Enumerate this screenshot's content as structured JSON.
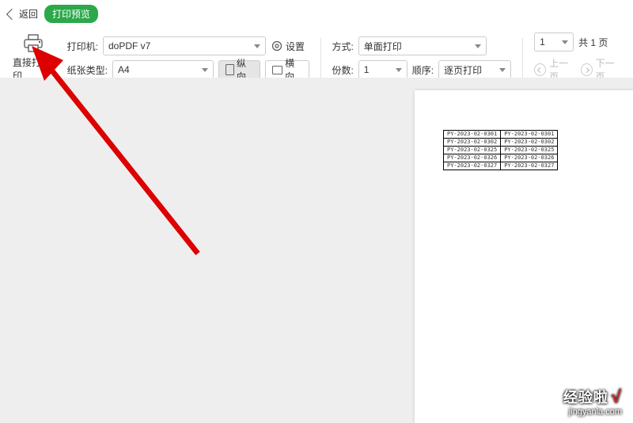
{
  "header": {
    "back": "返回",
    "title": "打印预览"
  },
  "toolbar": {
    "printAction": "直接打印",
    "printerLabel": "打印机:",
    "printer": "doPDF v7",
    "settings": "设置",
    "paperLabel": "纸张类型:",
    "paper": "A4",
    "orientPortrait": "纵向",
    "orientLandscape": "横向",
    "modeLabel": "方式:",
    "mode": "单面打印",
    "copiesLabel": "份数:",
    "copies": "1",
    "orderLabel": "顺序:",
    "order": "逐页打印",
    "pageInput": "1",
    "totalPages": "共 1 页",
    "prevPage": "上一页",
    "nextPage": "下一页"
  },
  "preview": {
    "tableRows": [
      [
        "PY-2023-02-0301",
        "PY-2023-02-0301"
      ],
      [
        "PY-2023-02-0302",
        "PY-2023-02-0302"
      ],
      [
        "PY-2023-02-0325",
        "PY-2023-02-0325"
      ],
      [
        "PY-2023-02-0326",
        "PY-2023-02-0326"
      ],
      [
        "PY-2023-02-0327",
        "PY-2023-02-0327"
      ]
    ]
  },
  "watermark": {
    "title": "经验啦",
    "url": "jingyanla.com"
  }
}
